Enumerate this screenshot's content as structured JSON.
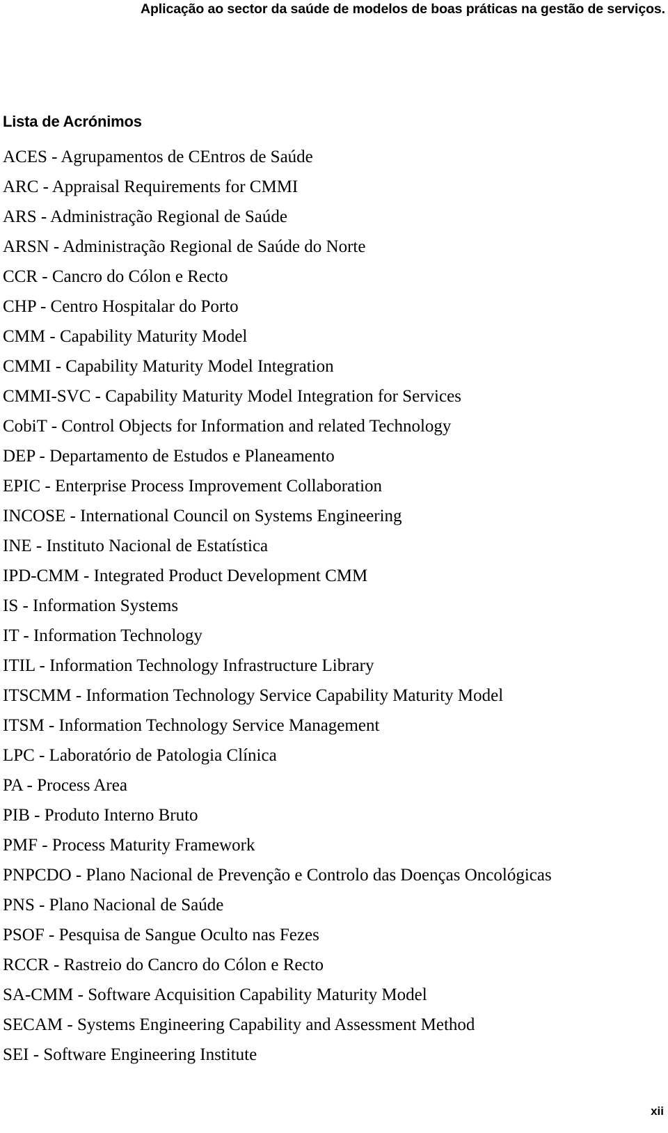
{
  "header": {
    "running_title": "Aplicação ao sector da saúde de modelos de boas práticas na gestão de serviços."
  },
  "section": {
    "title": "Lista de Acrónimos"
  },
  "acronyms": [
    {
      "text": "ACES - Agrupamentos de CEntros de Saúde"
    },
    {
      "text": "ARC - Appraisal Requirements for CMMI"
    },
    {
      "text": "ARS - Administração Regional de Saúde"
    },
    {
      "text": "ARSN - Administração Regional de Saúde do Norte"
    },
    {
      "text": "CCR - Cancro do Cólon e Recto"
    },
    {
      "text": "CHP - Centro Hospitalar do Porto"
    },
    {
      "text": "CMM - Capability Maturity Model"
    },
    {
      "text": "CMMI - Capability Maturity Model Integration"
    },
    {
      "text": "CMMI-SVC - Capability Maturity Model Integration for Services"
    },
    {
      "text": "CobiT - Control Objects for Information and related Technology"
    },
    {
      "text": "DEP - Departamento de Estudos e Planeamento"
    },
    {
      "text": "EPIC - Enterprise Process Improvement Collaboration"
    },
    {
      "text": "INCOSE - International Council on Systems Engineering"
    },
    {
      "text": "INE - Instituto Nacional de Estatística"
    },
    {
      "text": "IPD-CMM - Integrated Product Development CMM"
    },
    {
      "text": "IS - Information Systems"
    },
    {
      "text": "IT - Information Technology"
    },
    {
      "text": "ITIL - Information Technology Infrastructure Library"
    },
    {
      "text": "ITSCMM - Information Technology Service Capability Maturity Model"
    },
    {
      "text": "ITSM - Information Technology Service Management"
    },
    {
      "text": "LPC - Laboratório de Patologia Clínica"
    },
    {
      "text": "PA - Process Area"
    },
    {
      "text": "PIB - Produto Interno Bruto"
    },
    {
      "text": "PMF - Process Maturity Framework"
    },
    {
      "text": "PNPCDO - Plano Nacional de Prevenção e Controlo das Doenças Oncológicas"
    },
    {
      "text": "PNS - Plano Nacional de Saúde"
    },
    {
      "text": "PSOF - Pesquisa de Sangue Oculto nas Fezes"
    },
    {
      "text": "RCCR - Rastreio do Cancro do Cólon e Recto"
    },
    {
      "text": "SA-CMM - Software Acquisition Capability Maturity Model"
    },
    {
      "text": "SECAM - Systems Engineering Capability and Assessment Method"
    },
    {
      "text": "SEI - Software Engineering Institute"
    }
  ],
  "footer": {
    "page_number": "xii"
  },
  "colors": {
    "page_background": "#ffffff",
    "text": "#000000"
  }
}
